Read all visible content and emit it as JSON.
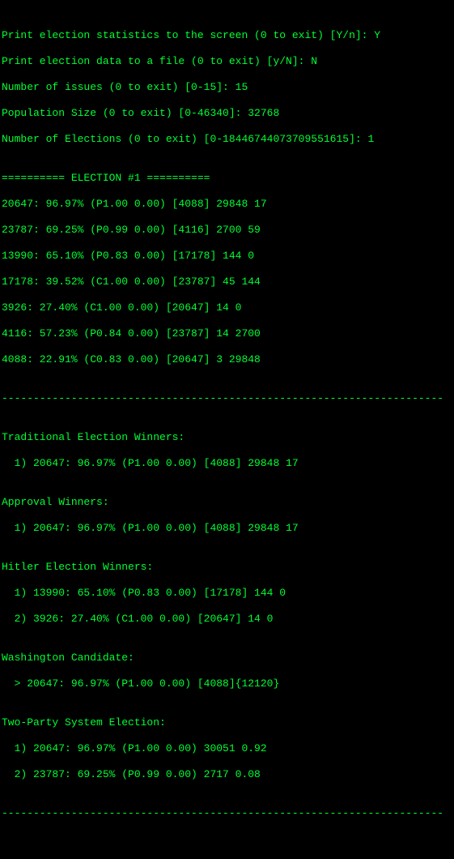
{
  "prompts": {
    "print_screen": "Print election statistics to the screen (0 to exit) [Y/n]: Y",
    "print_file": "Print election data to a file (0 to exit) [y/N]: N",
    "num_issues": "Number of issues (0 to exit) [0-15]: 15",
    "pop_size": "Population Size (0 to exit) [0-46340]: 32768",
    "num_elections": "Number of Elections (0 to exit) [0-18446744073709551615]: 1"
  },
  "header": {
    "line": "========== ELECTION #1 =========="
  },
  "raw": {
    "r1": "20647: 96.97% (P1.00 0.00) [4088] 29848 17",
    "r2": "23787: 69.25% (P0.99 0.00) [4116] 2700 59",
    "r3": "13990: 65.10% (P0.83 0.00) [17178] 144 0",
    "r4": "17178: 39.52% (C1.00 0.00) [23787] 45 144",
    "r5": "3926: 27.40% (C1.00 0.00) [20647] 14 0",
    "r6": "4116: 57.23% (P0.84 0.00) [23787] 14 2700",
    "r7": "4088: 22.91% (C0.83 0.00) [20647] 3 29848"
  },
  "sep": "----------------------------------------------------------------------",
  "sections": {
    "traditional": {
      "title": "Traditional Election Winners:",
      "l1": "  1) 20647: 96.97% (P1.00 0.00) [4088] 29848 17"
    },
    "approval": {
      "title": "Approval Winners:",
      "l1": "  1) 20647: 96.97% (P1.00 0.00) [4088] 29848 17"
    },
    "hitler": {
      "title": "Hitler Election Winners:",
      "l1": "  1) 13990: 65.10% (P0.83 0.00) [17178] 144 0",
      "l2": "  2) 3926: 27.40% (C1.00 0.00) [20647] 14 0"
    },
    "washington": {
      "title": "Washington Candidate:",
      "l1": "  > 20647: 96.97% (P1.00 0.00) [4088]{12120}"
    },
    "twoparty": {
      "title": "Two-Party System Election:",
      "l1": "  1) 20647: 96.97% (P1.00 0.00) 30051 0.92",
      "l2": "  2) 23787: 69.25% (P0.99 0.00) 2717 0.08"
    }
  },
  "blank": ""
}
